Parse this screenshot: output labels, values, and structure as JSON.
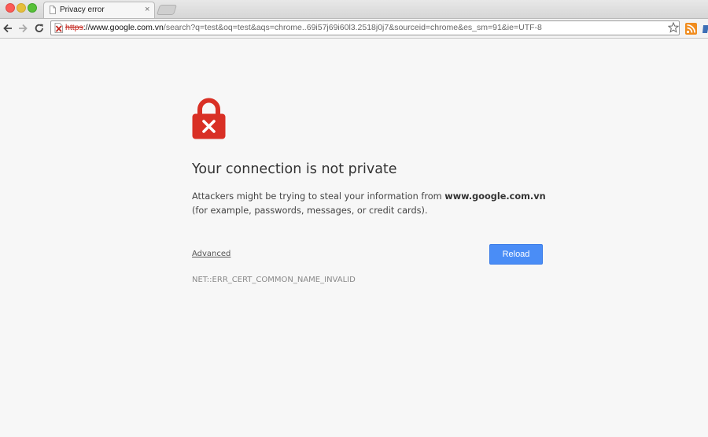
{
  "window": {
    "tab_title": "Privacy error",
    "tab_close": "×",
    "omnibox": {
      "scheme": "https",
      "host": "://www.google.com.vn",
      "path": "/search?q=test&oq=test&aqs=chrome..69i57j69i60l3.2518j0j7&sourceid=chrome&es_sm=91&ie=UTF-8"
    }
  },
  "interstitial": {
    "heading": "Your connection is not private",
    "explanation_before": "Attackers might be trying to steal your information from ",
    "explanation_host": "www.google.com.vn",
    "explanation_after": " (for example, passwords, messages, or credit cards).",
    "advanced_label": "Advanced",
    "reload_label": "Reload",
    "error_code": "NET::ERR_CERT_COMMON_NAME_INVALID"
  },
  "colors": {
    "lock_red": "#d93025",
    "reload_blue": "#4a8df6",
    "page_background": "#f7f7f7"
  }
}
